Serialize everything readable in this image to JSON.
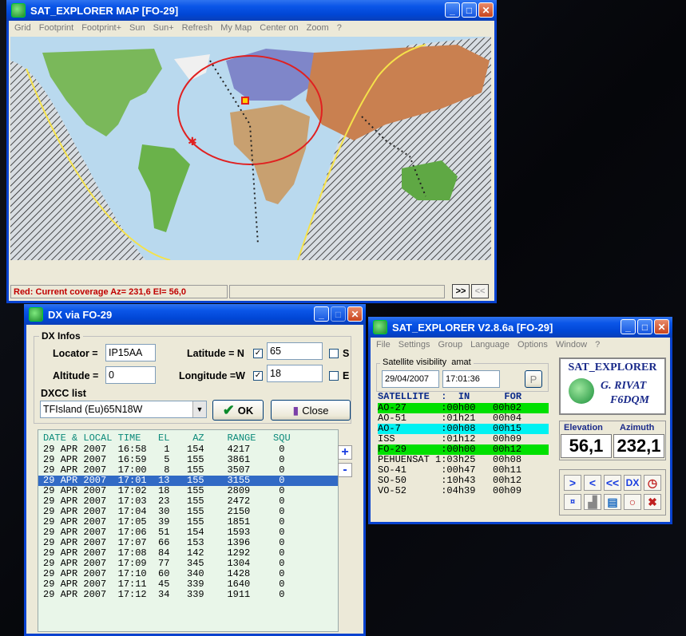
{
  "map_window": {
    "title": "SAT_EXPLORER MAP [FO-29]",
    "menu": [
      "Grid",
      "Footprint",
      "Footprint+",
      "Sun",
      "Sun+",
      "Refresh",
      "My Map",
      "Center on",
      "Zoom",
      "?"
    ],
    "status": "Red: Current coverage Az= 231,6   El= 56,0",
    "nav_next": ">>",
    "nav_prev": "<<",
    "colors": {
      "ocean": "#b9d9ee",
      "coverage": "#e02020",
      "terminator": "#f5e24a"
    }
  },
  "dx_window": {
    "title": "DX via FO-29",
    "group_title": "DX Infos",
    "locator_label": "Locator =",
    "locator_value": "IP15AA",
    "altitude_label": "Altitude =",
    "altitude_value": "0",
    "latitude_label": "Latitude = N",
    "latitude_value": "65",
    "latitude_s_label": "S",
    "longitude_label": "Longitude =W",
    "longitude_value": "18",
    "longitude_e_label": "E",
    "dxcc_label": "DXCC list",
    "dxcc_value": "TFIsland (Eu)65N18W",
    "ok_label": "OK",
    "close_label": "Close",
    "list_header": "DATE & LOCAL TIME   EL    AZ    RANGE   SQU",
    "plus": "+",
    "minus": "-",
    "rows": [
      "29 APR 2007  16:58   1   154    4217     0",
      "29 APR 2007  16:59   5   155    3861     0",
      "29 APR 2007  17:00   8   155    3507     0",
      "29 APR 2007  17:01  13   155    3155     0",
      "29 APR 2007  17:02  18   155    2809     0",
      "29 APR 2007  17:03  23   155    2472     0",
      "29 APR 2007  17:04  30   155    2150     0",
      "29 APR 2007  17:05  39   155    1851     0",
      "29 APR 2007  17:06  51   154    1593     0",
      "29 APR 2007  17:07  66   153    1396     0",
      "29 APR 2007  17:08  84   142    1292     0",
      "29 APR 2007  17:09  77   345    1304     0",
      "29 APR 2007  17:10  60   340    1428     0",
      "29 APR 2007  17:11  45   339    1640     0",
      "29 APR 2007  17:12  34   339    1911     0"
    ]
  },
  "sat_window": {
    "title": "SAT_EXPLORER V2.8.6a  [FO-29]",
    "menu": [
      "File",
      "Settings",
      "Group",
      "Language",
      "Options",
      "Window",
      "?"
    ],
    "visibility_label": "Satellite visibility",
    "visibility_group": "amat",
    "date": "29/04/2007",
    "time": "17:01:36",
    "p_button": "P",
    "header": "SATELLITE  :  IN      FOR",
    "sats": [
      {
        "row": "AO-27      :00h00   00h02",
        "hl": "g"
      },
      {
        "row": "AO-51      :01h21   00h04",
        "hl": ""
      },
      {
        "row": "AO-7       :00h08   00h15",
        "hl": "c"
      },
      {
        "row": "ISS        :01h12   00h09",
        "hl": ""
      },
      {
        "row": "FO-29      :00h00   00h12",
        "hl": "g"
      },
      {
        "row": "PEHUENSAT 1:03h25   00h08",
        "hl": ""
      },
      {
        "row": "SO-41      :00h47   00h11",
        "hl": ""
      },
      {
        "row": "SO-50      :10h43   00h12",
        "hl": ""
      },
      {
        "row": "VO-52      :04h39   00h09",
        "hl": ""
      }
    ],
    "logo_title": "SAT_EXPLORER",
    "logo_author": "G. RIVAT",
    "logo_call": "F6DQM",
    "elevation_label": "Elevation",
    "elevation_value": "56,1",
    "azimuth_label": "Azimuth",
    "azimuth_value": "232,1",
    "controls": [
      ">",
      "<",
      "<<",
      "DX"
    ]
  }
}
